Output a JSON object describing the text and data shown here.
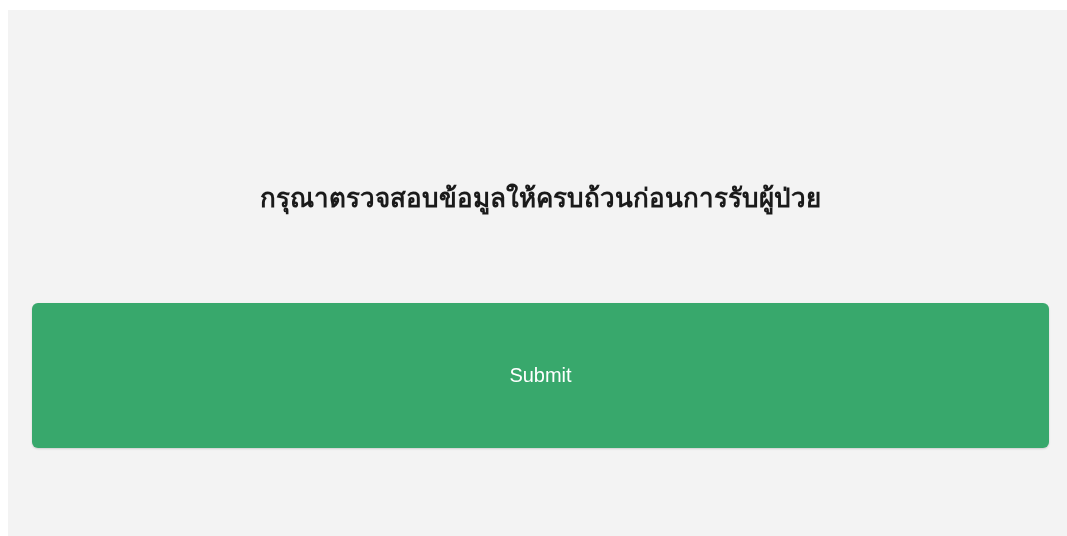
{
  "message": "กรุณาตรวจสอบข้อมูลให้ครบถ้วนก่อนการรับผู้ป่วย",
  "submit_button": {
    "label": "Submit"
  }
}
